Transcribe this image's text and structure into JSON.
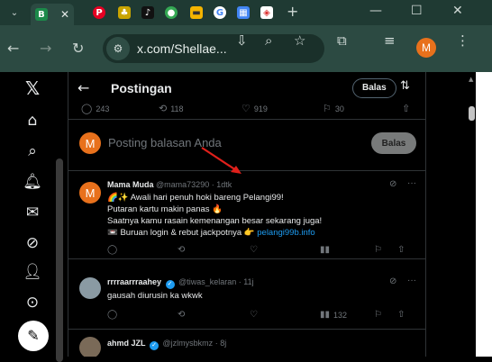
{
  "browser": {
    "url": "x.com/Shellae...",
    "profile_initial": "M",
    "tabs": [
      {
        "icon": "blogger-icon",
        "glyph": "B",
        "color": "#1c8a4a"
      },
      {
        "icon": "pinterest-icon",
        "glyph": "P",
        "color": "#e60023"
      },
      {
        "icon": "app-icon",
        "glyph": "♪",
        "color": "#c9a400"
      },
      {
        "icon": "tiktok-icon",
        "glyph": "♪",
        "color": "#111111"
      },
      {
        "icon": "maps-icon",
        "glyph": "◉",
        "color": "#34a853"
      },
      {
        "icon": "card-icon",
        "glyph": "▬",
        "color": "#f4b400"
      },
      {
        "icon": "google-icon",
        "glyph": "G",
        "color": "#ffffff"
      },
      {
        "icon": "calendar-icon",
        "glyph": "▦",
        "color": "#4285f4"
      },
      {
        "icon": "gallery-icon",
        "glyph": "◈",
        "color": "#ffffff"
      }
    ]
  },
  "header": {
    "title": "Postingan",
    "reply_button": "Balas"
  },
  "stats": {
    "replies": "243",
    "reposts": "118",
    "likes": "919",
    "bookmarks": "30"
  },
  "composer": {
    "avatar_initial": "M",
    "placeholder": "Posting balasan Anda",
    "button": "Balas"
  },
  "posts": [
    {
      "name": "Mama Muda",
      "handle": "@mama73290",
      "time": "1dtk",
      "avatar_initial": "M",
      "lines": [
        "🌈✨ Awali hari penuh hoki bareng Pelangi99!",
        "Putaran kartu makin panas 🔥",
        "Saatnya kamu rasain kemenangan besar sekarang juga!",
        "📼 Buruan login & rebut jackpotnya 👉 "
      ],
      "link": "pelangi99b.info",
      "views": ""
    },
    {
      "name": "rrrraarrraahey",
      "handle": "@tiwas_kelaran",
      "time": "11j",
      "lines": [
        "gausah diurusin ka wkwk"
      ],
      "views": "132"
    },
    {
      "name": "ahmd JZL",
      "handle": "@jzlmysbkmz",
      "time": "8j",
      "lines": []
    }
  ]
}
